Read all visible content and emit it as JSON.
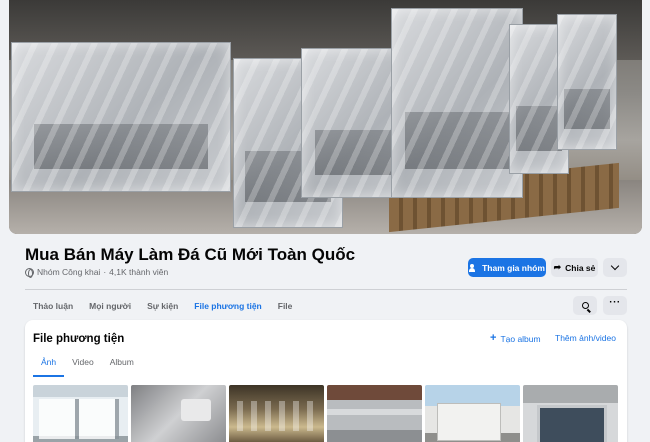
{
  "group": {
    "name": "Mua Bán Máy Làm Đá Cũ Mới Toàn Quốc",
    "privacy": "Nhóm Công khai",
    "separator": "·",
    "members": "4,1K thành viên"
  },
  "actions": {
    "join_label": "Tham gia nhóm",
    "share_label": "Chia sẻ",
    "join_color": "#1b74e4"
  },
  "tabs": [
    {
      "label": "Thảo luận"
    },
    {
      "label": "Mọi người"
    },
    {
      "label": "Sự kiện"
    },
    {
      "label": "File phương tiện",
      "active": true
    },
    {
      "label": "File"
    }
  ],
  "media": {
    "title": "File phương tiện",
    "create_album": "Tạo album",
    "add_media": "Thêm ảnh/video",
    "subtabs": [
      {
        "label": "Ảnh",
        "active": true
      },
      {
        "label": "Video"
      },
      {
        "label": "Album"
      }
    ]
  },
  "icons": {
    "join": "people-icon",
    "share": "share-arrow-icon",
    "more": "chevron-down-icon",
    "search": "search-icon",
    "options": "more-dots-icon",
    "create_album": "plus-icon"
  }
}
